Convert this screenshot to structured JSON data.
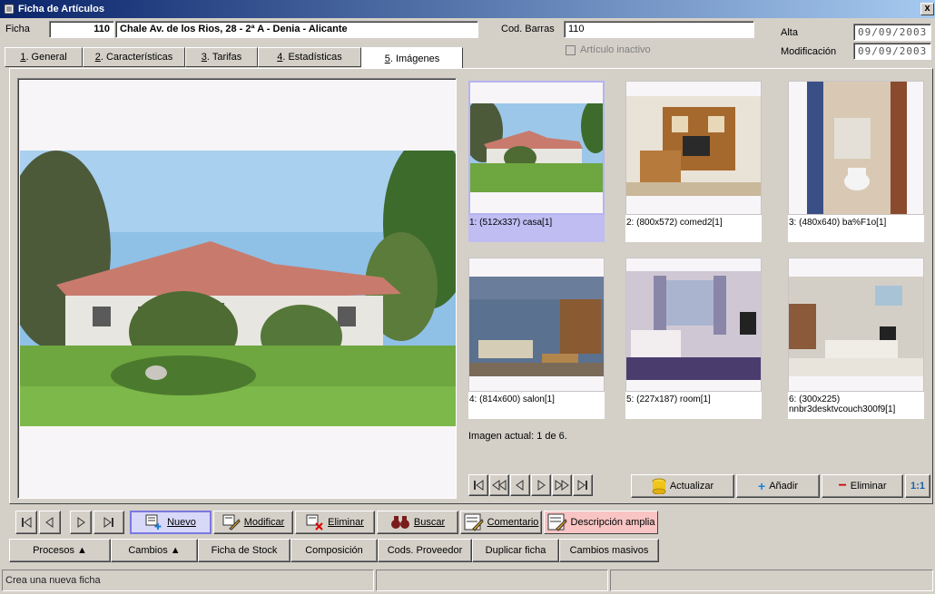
{
  "window": {
    "title": "Ficha de Artículos",
    "close_glyph": "x"
  },
  "header": {
    "ficha_label": "Ficha",
    "ficha_code": "110",
    "ficha_name": "Chale Av. de los Rios, 28 - 2ª A - Denia - Alicante",
    "barcode_label": "Cod. Barras",
    "barcode_value": "110",
    "inactive_label": "Artículo inactivo",
    "inactive_checked": false,
    "alta_label": "Alta",
    "alta_value": "09/09/2003",
    "mod_label": "Modificación",
    "mod_value": "09/09/2003"
  },
  "tabs": [
    {
      "num": "1",
      "label": ". General"
    },
    {
      "num": "2",
      "label": ". Características"
    },
    {
      "num": "3",
      "label": ". Tarifas"
    },
    {
      "num": "4",
      "label": ". Estadísticas"
    },
    {
      "num": "5",
      "label": ". Imágenes",
      "active": true
    }
  ],
  "gallery": {
    "thumbs": [
      {
        "caption": "1: (512x337) casa[1]",
        "selected": true,
        "icon": "house-photo"
      },
      {
        "caption": "2: (800x572) comed2[1]",
        "icon": "dining-room-photo"
      },
      {
        "caption": "3: (480x640) ba%F1o[1]",
        "icon": "bathroom-photo"
      },
      {
        "caption": "4: (814x600) salon[1]",
        "icon": "living-room-photo"
      },
      {
        "caption": "5: (227x187) room[1]",
        "icon": "bedroom-photo"
      },
      {
        "caption": "6: (300x225) nnbr3desktvcouch300f9[1]",
        "icon": "lounge-photo"
      }
    ],
    "current_text": "Imagen actual: 1 de 6.",
    "refresh_label": "Actualizar",
    "add_label": "Añadir",
    "delete_label": "Eliminar",
    "ratio_label": "1:1"
  },
  "toolbar": {
    "nuevo": "Nuevo",
    "modificar": "Modificar",
    "eliminar": "Eliminar",
    "buscar": "Buscar",
    "comentario": "Comentario",
    "descripcion": "Descripción amplia"
  },
  "bottom_buttons": {
    "procesos": "Procesos ▲",
    "cambios": "Cambios ▲",
    "ficha_stock": "Ficha de Stock",
    "composicion": "Composición",
    "cods_proveedor": "Cods. Proveedor",
    "duplicar": "Duplicar ficha",
    "cambios_masivos": "Cambios masivos"
  },
  "status": {
    "message": "Crea una nueva ficha"
  },
  "colors": {
    "selection": "#c0bdf3",
    "title_gradient_start": "#0a246a",
    "delete_red": "#cc0000",
    "add_blue": "#1e7fd8"
  }
}
